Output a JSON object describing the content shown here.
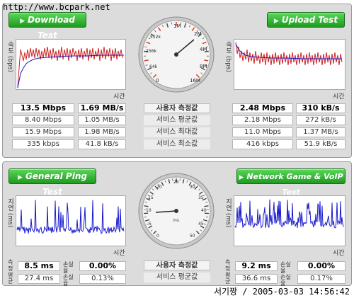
{
  "watermark": "http://www.bcpark.net",
  "footer": "서기짱 / 2005-03-03 14:56:42",
  "speed": {
    "download_button": "Download Test",
    "upload_button": "Upload Test",
    "y_label": "속도 (bps)",
    "x_label": "시간",
    "row_labels": [
      "사용자 측정값",
      "서비스 평균값",
      "서비스 최대값",
      "서비스 최소값"
    ],
    "download_rows": [
      [
        "13.5 Mbps",
        "1.69 MB/s"
      ],
      [
        "8.40 Mbps",
        "1.05 MB/s"
      ],
      [
        "15.9 Mbps",
        "1.98 MB/s"
      ],
      [
        "335 kbps",
        "41.8 kB/s"
      ]
    ],
    "upload_rows": [
      [
        "2.48 Mbps",
        "310 kB/s"
      ],
      [
        "2.18 Mbps",
        "272 kB/s"
      ],
      [
        "11.0 Mbps",
        "1.37 MB/s"
      ],
      [
        "416 kbps",
        "51.9 kB/s"
      ]
    ],
    "gauge_ticks": [
      "0",
      "64k",
      "256k",
      "512k",
      "1M",
      "2M",
      "4M",
      "8M",
      "16M"
    ]
  },
  "ping": {
    "ping_button": "General Ping Test",
    "game_button": "Network Game & VoIP Test",
    "y_label": "지연 (ms)",
    "x_label": "시간",
    "row_labels": [
      "사용자 측정값",
      "서비스 평균값"
    ],
    "col_latency": "지연",
    "col_loss": "손실율",
    "row_head_1": "측정",
    "row_head_2": "평균",
    "ping_rows": [
      [
        "8.5 ms",
        "0.00%"
      ],
      [
        "27.4 ms",
        "0.13%"
      ]
    ],
    "game_rows": [
      [
        "9.2 ms",
        "0.00%"
      ],
      [
        "36.6 ms",
        "0.17%"
      ]
    ],
    "gauge_ticks": [
      "0",
      "5",
      "10",
      "15",
      "20",
      "25",
      "30",
      "35",
      "40",
      "45",
      "50"
    ],
    "gauge_unit": "ms"
  },
  "colors": {
    "accent_green": "#22a822",
    "line_red": "#cc2222",
    "line_blue": "#1a1acc",
    "panel_bg": "#dcdcdc"
  }
}
